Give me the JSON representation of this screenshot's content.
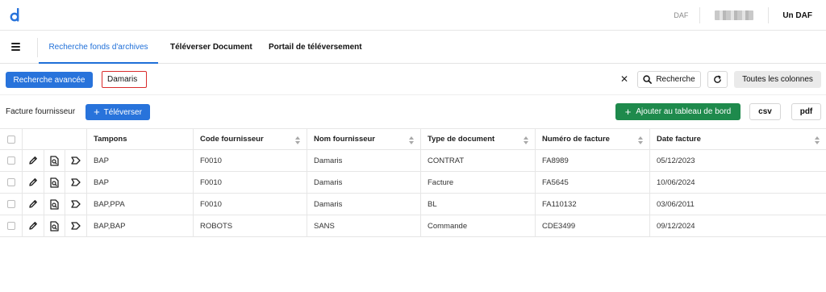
{
  "header": {
    "role_label": "DAF",
    "user_name": "Un DAF"
  },
  "nav": {
    "tabs": [
      {
        "label": "Recherche fonds d'archives"
      },
      {
        "label": "Téléverser Document"
      },
      {
        "label": "Portail de téléversement"
      }
    ]
  },
  "search": {
    "advanced_label": "Recherche avancée",
    "query_value": "Damaris",
    "clear_label": "✕",
    "search_button_label": "Recherche",
    "columns_button_label": "Toutes les colonnes"
  },
  "toolbar": {
    "section_label": "Facture fournisseur",
    "upload_label": "Téléverser",
    "dashboard_label": "Ajouter au tableau de bord",
    "csv_label": "csv",
    "pdf_label": "pdf"
  },
  "table": {
    "columns": [
      "Tampons",
      "Code fournisseur",
      "Nom fournisseur",
      "Type de document",
      "Numéro de facture",
      "Date facture"
    ],
    "rows": [
      [
        "BAP",
        "F0010",
        "Damaris",
        "CONTRAT",
        "FA8989",
        "05/12/2023"
      ],
      [
        "BAP",
        "F0010",
        "Damaris",
        "Facture",
        "FA5645",
        "10/06/2024"
      ],
      [
        "BAP,PPA",
        "F0010",
        "Damaris",
        "BL",
        "FA110132",
        "03/06/2011"
      ],
      [
        "BAP,BAP",
        "ROBOTS",
        "SANS",
        "Commande",
        "CDE3499",
        "09/12/2024"
      ]
    ]
  },
  "colors": {
    "primary": "#2873db",
    "success": "#1e8a4c",
    "error_border": "#d92b2b"
  }
}
